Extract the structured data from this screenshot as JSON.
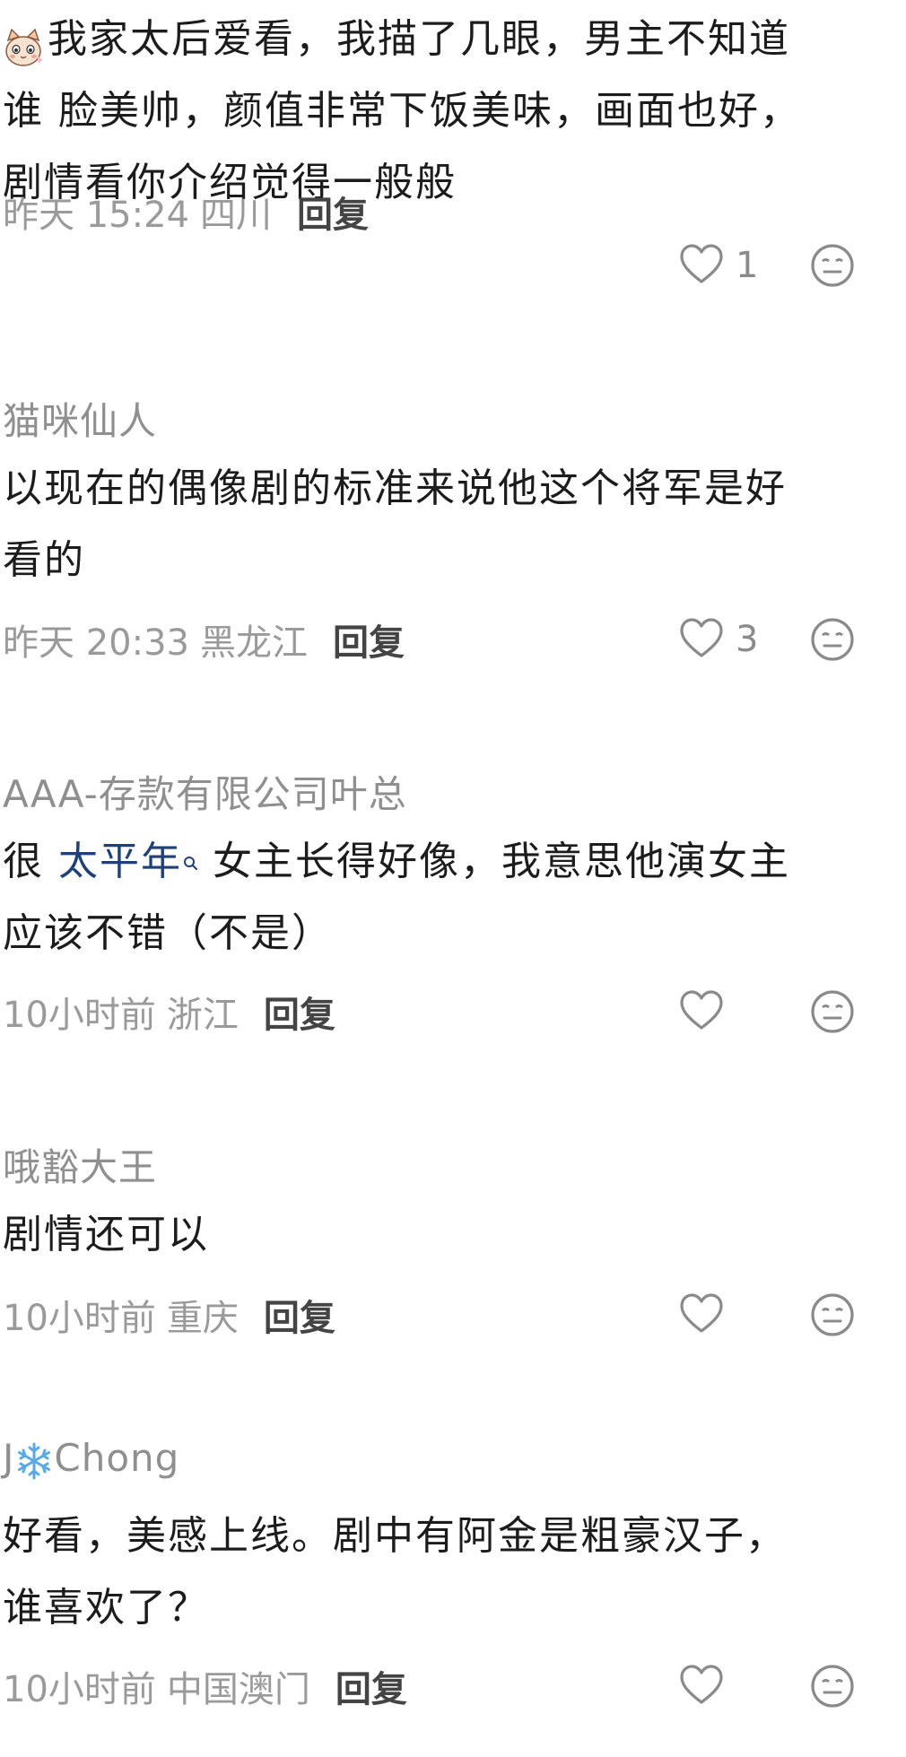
{
  "comments": [
    {
      "username": "",
      "lines": [
        "我家太后爱看，我描了几眼，男主不知道",
        "谁 脸美帅，颜值非常下饭美味，画面也好，",
        "剧情看你介绍觉得一般般"
      ],
      "time": "昨天 15:24",
      "location": "四川",
      "reply": "回复",
      "likes": "1"
    },
    {
      "username": "猫咪仙人",
      "lines": [
        "以现在的偶像剧的标准来说他这个将军是好",
        "看的"
      ],
      "time": "昨天 20:33",
      "location": "黑龙江",
      "reply": "回复",
      "likes": "3"
    },
    {
      "username": "AAA-存款有限公司叶总",
      "line1_prefix": "很 ",
      "line1_link": "太平年",
      "line1_suffix": " 女主长得好像，我意思他演女主",
      "lines": [
        "应该不错（不是）"
      ],
      "time": "10小时前",
      "location": "浙江",
      "reply": "回复",
      "likes": ""
    },
    {
      "username": "哦豁大王",
      "lines": [
        "剧情还可以"
      ],
      "time": "10小时前",
      "location": "重庆",
      "reply": "回复",
      "likes": ""
    },
    {
      "username_prefix": "J",
      "username_suffix": "Chong",
      "lines": [
        "好看，美感上线。剧中有阿金是粗豪汉子，",
        "谁喜欢了？"
      ],
      "time": "10小时前",
      "location": "中国澳门",
      "reply": "回复",
      "likes": ""
    }
  ],
  "icons": {
    "like": "heart-outline-icon",
    "dislike": "meh-face-icon",
    "search": "search-icon",
    "avatar": "cat-face-emoji",
    "snowflake": "snowflake-emoji"
  },
  "colors": {
    "link": "#20407a",
    "meta": "#9a9a9a",
    "username": "#8f8f8f",
    "text": "#1c1c1c"
  }
}
